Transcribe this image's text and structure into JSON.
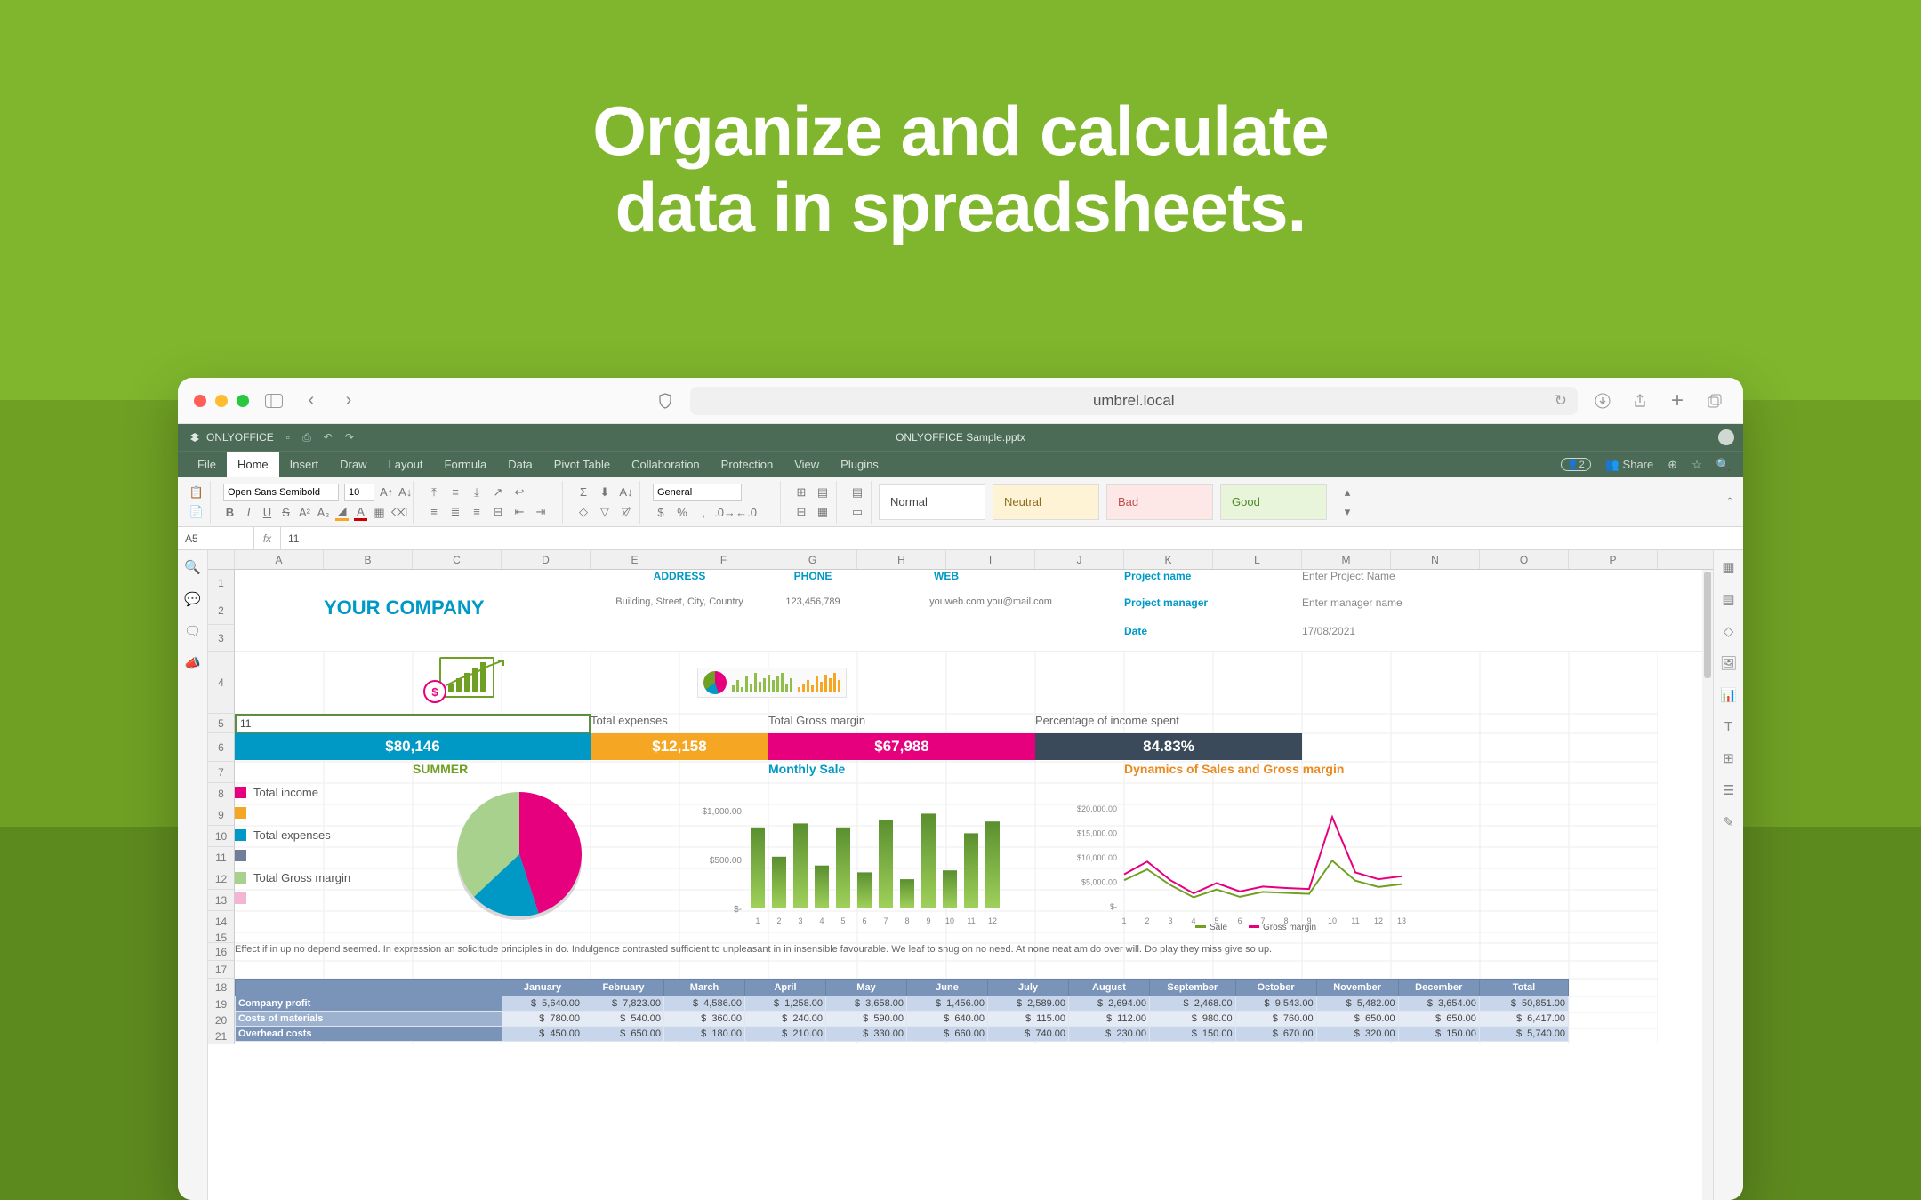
{
  "hero": {
    "title_line1": "Organize and calculate",
    "title_line2": "data in spreadsheets."
  },
  "browser": {
    "url": "umbrel.local"
  },
  "app": {
    "brand": "ONLYOFFICE",
    "document_title": "ONLYOFFICE Sample.pptx",
    "menu": {
      "file": "File",
      "home": "Home",
      "insert": "Insert",
      "draw": "Draw",
      "layout": "Layout",
      "formula": "Formula",
      "data": "Data",
      "pivot": "Pivot Table",
      "collab": "Collaboration",
      "protect": "Protection",
      "view": "View",
      "plugins": "Plugins"
    },
    "right_menu": {
      "users_badge": "2",
      "share": "Share"
    },
    "ribbon": {
      "font": "Open Sans Semibold",
      "size": "10",
      "number_format": "General",
      "styles": {
        "normal": "Normal",
        "neutral": "Neutral",
        "bad": "Bad",
        "good": "Good"
      }
    },
    "namebox": "A5",
    "formula_value": "11"
  },
  "columns": [
    "A",
    "B",
    "C",
    "D",
    "E",
    "F",
    "G",
    "H",
    "I",
    "J",
    "K",
    "L",
    "M",
    "N",
    "O",
    "P"
  ],
  "rows_visible": [
    "1",
    "2",
    "3",
    "4",
    "5",
    "6",
    "7",
    "8",
    "9",
    "10",
    "11",
    "12",
    "13",
    "14",
    "15",
    "16",
    "17",
    "18",
    "19",
    "20",
    "21"
  ],
  "cell_a5": "11",
  "company": {
    "name": "YOUR COMPANY",
    "address_label": "ADDRESS",
    "address": "Building, Street, City, Country",
    "phone_label": "PHONE",
    "phone": "123,456,789",
    "web_label": "WEB",
    "web": "youweb.com you@mail.com"
  },
  "project": {
    "name_label": "Project name",
    "name_value": "Enter Project Name",
    "manager_label": "Project manager",
    "manager_value": "Enter manager name",
    "date_label": "Date",
    "date_value": "17/08/2021"
  },
  "metrics": {
    "income_label": "",
    "expenses_label": "Total expenses",
    "gross_label": "Total Gross margin",
    "pct_label": "Percentage of income spent",
    "income": "$80,146",
    "expenses": "$12,158",
    "gross": "$67,988",
    "pct": "84.83%"
  },
  "legend": {
    "income": "Total income",
    "expenses": "Total expenses",
    "gross": "Total Gross margin",
    "colors": {
      "income": "#e6007e",
      "expenses": "#0099c6",
      "gross": "#a9d18e",
      "extra1": "#f5a623",
      "extra2": "#6f7f99",
      "extra3": "#f2b5d4"
    }
  },
  "charts": {
    "summer": {
      "title": "SUMMER"
    },
    "monthly": {
      "title": "Monthly Sale"
    },
    "dynamics": {
      "title": "Dynamics of Sales and Gross margin",
      "legend_sale": "Sale",
      "legend_margin": "Gross margin"
    }
  },
  "note_text": "Effect if in up no depend seemed. In expression an solicitude principles in do. Indulgence contrasted sufficient to unpleasant in in insensible favourable. We leaf to snug on no need. At none neat am do over will. Do play they miss give so up.",
  "months": [
    "January",
    "February",
    "March",
    "April",
    "May",
    "June",
    "July",
    "August",
    "September",
    "October",
    "November",
    "December",
    "Total"
  ],
  "table": {
    "profit_label": "Company profit",
    "profit": [
      "5,640.00",
      "7,823.00",
      "4,586.00",
      "1,258.00",
      "3,658.00",
      "1,456.00",
      "2,589.00",
      "2,694.00",
      "2,468.00",
      "9,543.00",
      "5,482.00",
      "3,654.00",
      "50,851.00"
    ],
    "cost_label": "Costs of materials",
    "cost": [
      "780.00",
      "540.00",
      "360.00",
      "240.00",
      "590.00",
      "640.00",
      "115.00",
      "112.00",
      "980.00",
      "760.00",
      "650.00",
      "650.00",
      "6,417.00"
    ],
    "over_label": "Overhead costs",
    "over": [
      "450.00",
      "650.00",
      "180.00",
      "210.00",
      "330.00",
      "660.00",
      "740.00",
      "230.00",
      "150.00",
      "670.00",
      "320.00",
      "150.00",
      "5,740.00"
    ]
  },
  "chart_data": [
    {
      "type": "pie",
      "title": "SUMMER",
      "series": [
        {
          "name": "Total income",
          "value": 45,
          "color": "#e6007e"
        },
        {
          "name": "Total expenses",
          "value": 18,
          "color": "#0099c6"
        },
        {
          "name": "Total Gross margin",
          "value": 37,
          "color": "#a9d18e"
        }
      ]
    },
    {
      "type": "bar",
      "title": "Monthly Sale",
      "ylabel": "",
      "ylim": [
        0,
        1000
      ],
      "yticks": [
        "$-",
        "$500.00",
        "$1,000.00"
      ],
      "categories": [
        "1",
        "2",
        "3",
        "4",
        "5",
        "6",
        "7",
        "8",
        "9",
        "10",
        "11",
        "12"
      ],
      "values": [
        820,
        520,
        860,
        430,
        820,
        360,
        900,
        290,
        960,
        380,
        760,
        880
      ]
    },
    {
      "type": "line",
      "title": "Dynamics of Sales and Gross margin",
      "ylim": [
        0,
        20000
      ],
      "yticks": [
        "$-",
        "$5,000.00",
        "$10,000.00",
        "$15,000.00",
        "$20,000.00"
      ],
      "x": [
        "1",
        "2",
        "3",
        "4",
        "5",
        "6",
        "7",
        "8",
        "9",
        "10",
        "11",
        "12",
        "13"
      ],
      "series": [
        {
          "name": "Sale",
          "color": "#6fa024",
          "values": [
            5600,
            7800,
            4600,
            2100,
            3700,
            2200,
            3200,
            3000,
            2800,
            9600,
            5500,
            4200,
            4800
          ]
        },
        {
          "name": "Gross margin",
          "color": "#e6007e",
          "values": [
            6800,
            9400,
            5600,
            2900,
            5000,
            3300,
            4300,
            4000,
            3800,
            18500,
            7200,
            5800,
            6400
          ]
        }
      ]
    }
  ]
}
